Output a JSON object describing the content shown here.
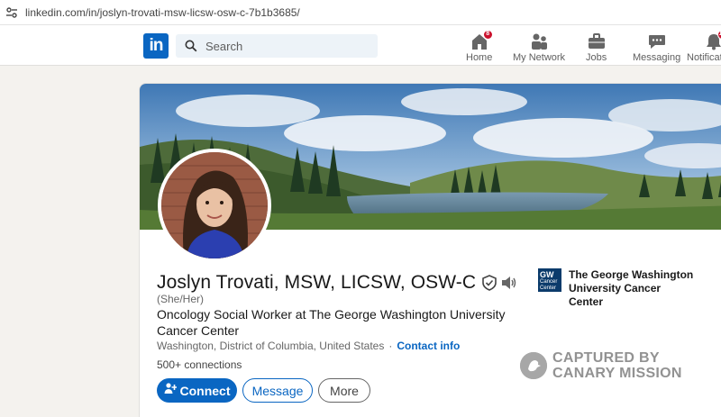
{
  "browser": {
    "url": "linkedin.com/in/joslyn-trovati-msw-licsw-osw-c-7b1b3685/"
  },
  "header": {
    "logo_text": "in",
    "search_placeholder": "Search",
    "nav": [
      {
        "label": "Home",
        "icon": "home-icon",
        "badge": "8"
      },
      {
        "label": "My Network",
        "icon": "people-icon",
        "badge": ""
      },
      {
        "label": "Jobs",
        "icon": "briefcase-icon",
        "badge": ""
      },
      {
        "label": "Messaging",
        "icon": "message-icon",
        "badge": ""
      },
      {
        "label": "Notifications",
        "icon": "bell-icon",
        "badge": "12"
      }
    ]
  },
  "profile": {
    "name": "Joslyn Trovati, MSW, LICSW, OSW-C",
    "pronouns": "(She/Her)",
    "headline": "Oncology Social Worker at The George Washington University Cancer Center",
    "location": "Washington, District of Columbia, United States",
    "location_separator": "·",
    "contact_info_label": "Contact info",
    "connections": "500+ connections",
    "buttons": {
      "connect": "Connect",
      "message": "Message",
      "more": "More"
    },
    "organization": {
      "name": "The George Washington University Cancer Center",
      "logo_short": "GW",
      "logo_sub": "Cancer Center"
    }
  },
  "watermark": {
    "line1": "CAPTURED BY",
    "line2": "CANARY MISSION"
  },
  "colors": {
    "brand": "#0a66c2",
    "badge": "#cb112d",
    "page_bg": "#f4f2ee"
  }
}
